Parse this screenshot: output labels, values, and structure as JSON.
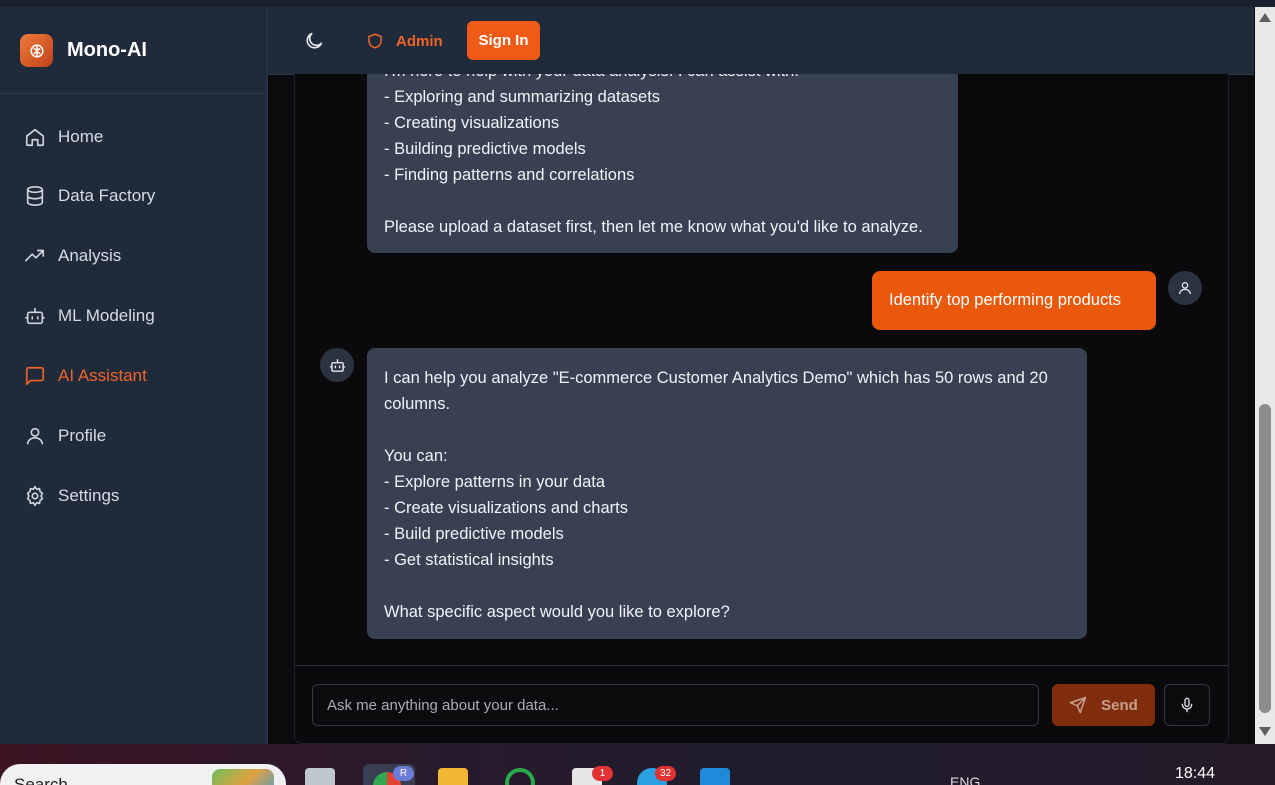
{
  "app": {
    "name": "Mono-AI",
    "accent": "#ea580c"
  },
  "sidebar": {
    "items": [
      {
        "label": "Home",
        "icon": "home-icon",
        "active": false
      },
      {
        "label": "Data Factory",
        "icon": "database-icon",
        "active": false
      },
      {
        "label": "Analysis",
        "icon": "trending-up-icon",
        "active": false
      },
      {
        "label": "ML Modeling",
        "icon": "bot-icon",
        "active": false
      },
      {
        "label": "AI Assistant",
        "icon": "message-square-icon",
        "active": true
      },
      {
        "label": "Profile",
        "icon": "user-icon",
        "active": false
      },
      {
        "label": "Settings",
        "icon": "gear-icon",
        "active": false
      }
    ]
  },
  "header": {
    "admin_label": "Admin",
    "signin_label": "Sign In"
  },
  "chat": {
    "messages": [
      {
        "role": "assistant",
        "text": "I'm here to help with your data analysis. I can assist with:\n- Exploring and summarizing datasets\n- Creating visualizations\n- Building predictive models\n- Finding patterns and correlations\n\nPlease upload a dataset first, then let me know what you'd like to analyze."
      },
      {
        "role": "user",
        "text": "Identify top performing products"
      },
      {
        "role": "assistant",
        "text": "I can help you analyze \"E-commerce Customer Analytics Demo\" which has 50 rows and 20 columns.\n\nYou can:\n- Explore patterns in your data\n- Create visualizations and charts\n- Build predictive models\n- Get statistical insights\n\nWhat specific aspect would you like to explore?"
      }
    ],
    "input_placeholder": "Ask me anything about your data...",
    "send_label": "Send"
  },
  "taskbar": {
    "search_text": "Search",
    "language": "ENG",
    "clock": "18:44",
    "badges": {
      "browser_profile": "R",
      "mail": "1",
      "telegram": "32"
    }
  }
}
